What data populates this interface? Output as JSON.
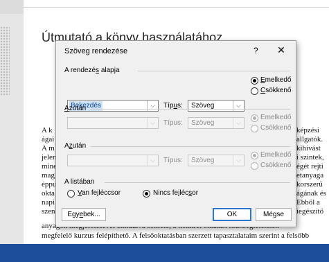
{
  "document": {
    "title": "Útmutató a könyv használatához",
    "body_lines": [
      "anyagok megjelölésével elindulva sokféle, a konkrét oktatási szükségleteknek",
      "megfelelő kurzus felépíthető. A felsőoktatásban szerzett tapasztalataim szerint a felsőbb"
    ],
    "left_fragments": [
      "A k",
      "ágai",
      "A m",
      "jelen",
      "mine",
      "mag",
      "éppu",
      "okta",
      "napi",
      "szen"
    ],
    "right_fragments": [
      "képzési",
      "allgatók.",
      "kihívást",
      "i szintek,",
      "égét rejti",
      "etanyaga",
      "korszerű",
      "ágának és",
      "Ebből a",
      "iegészítő"
    ]
  },
  "dialog": {
    "title": "Szöveg rendezése",
    "help": "?",
    "close": "✕",
    "sort_by": {
      "label_prefix": "A rendezé",
      "label_hot": "s",
      "label_suffix": " alapja",
      "field_value": "Bekezdés",
      "type_label_prefix": "Típ",
      "type_label_hot": "u",
      "type_label_suffix": "s:",
      "type_value": "Szöveg",
      "asc_hot": "E",
      "asc_rest": "melkedő",
      "desc_hot": "C",
      "desc_rest": "sökkenő"
    },
    "then1": {
      "label_hot": "A",
      "label_rest": "zután",
      "field_value": "",
      "type_label": "Típus:",
      "type_value": "Szöveg",
      "asc": "Emelkedő",
      "desc": "Csökkenő"
    },
    "then2": {
      "label_prefix": "A",
      "label_hot": "z",
      "label_rest": "után",
      "field_value": "",
      "type_label": "Típus:",
      "type_value": "Szöveg",
      "asc": "Emelkedő",
      "desc": "Csökkenő"
    },
    "list": {
      "label": "A listában",
      "header_hot": "V",
      "header_rest": "an fejléccsor",
      "noheader_prefix": "Nincs fejléc",
      "noheader_hot": "s",
      "noheader_rest": "or"
    },
    "buttons": {
      "options_prefix": "Egy",
      "options_hot": "e",
      "options_rest": "bek...",
      "ok": "OK",
      "cancel": "Mégse"
    }
  }
}
